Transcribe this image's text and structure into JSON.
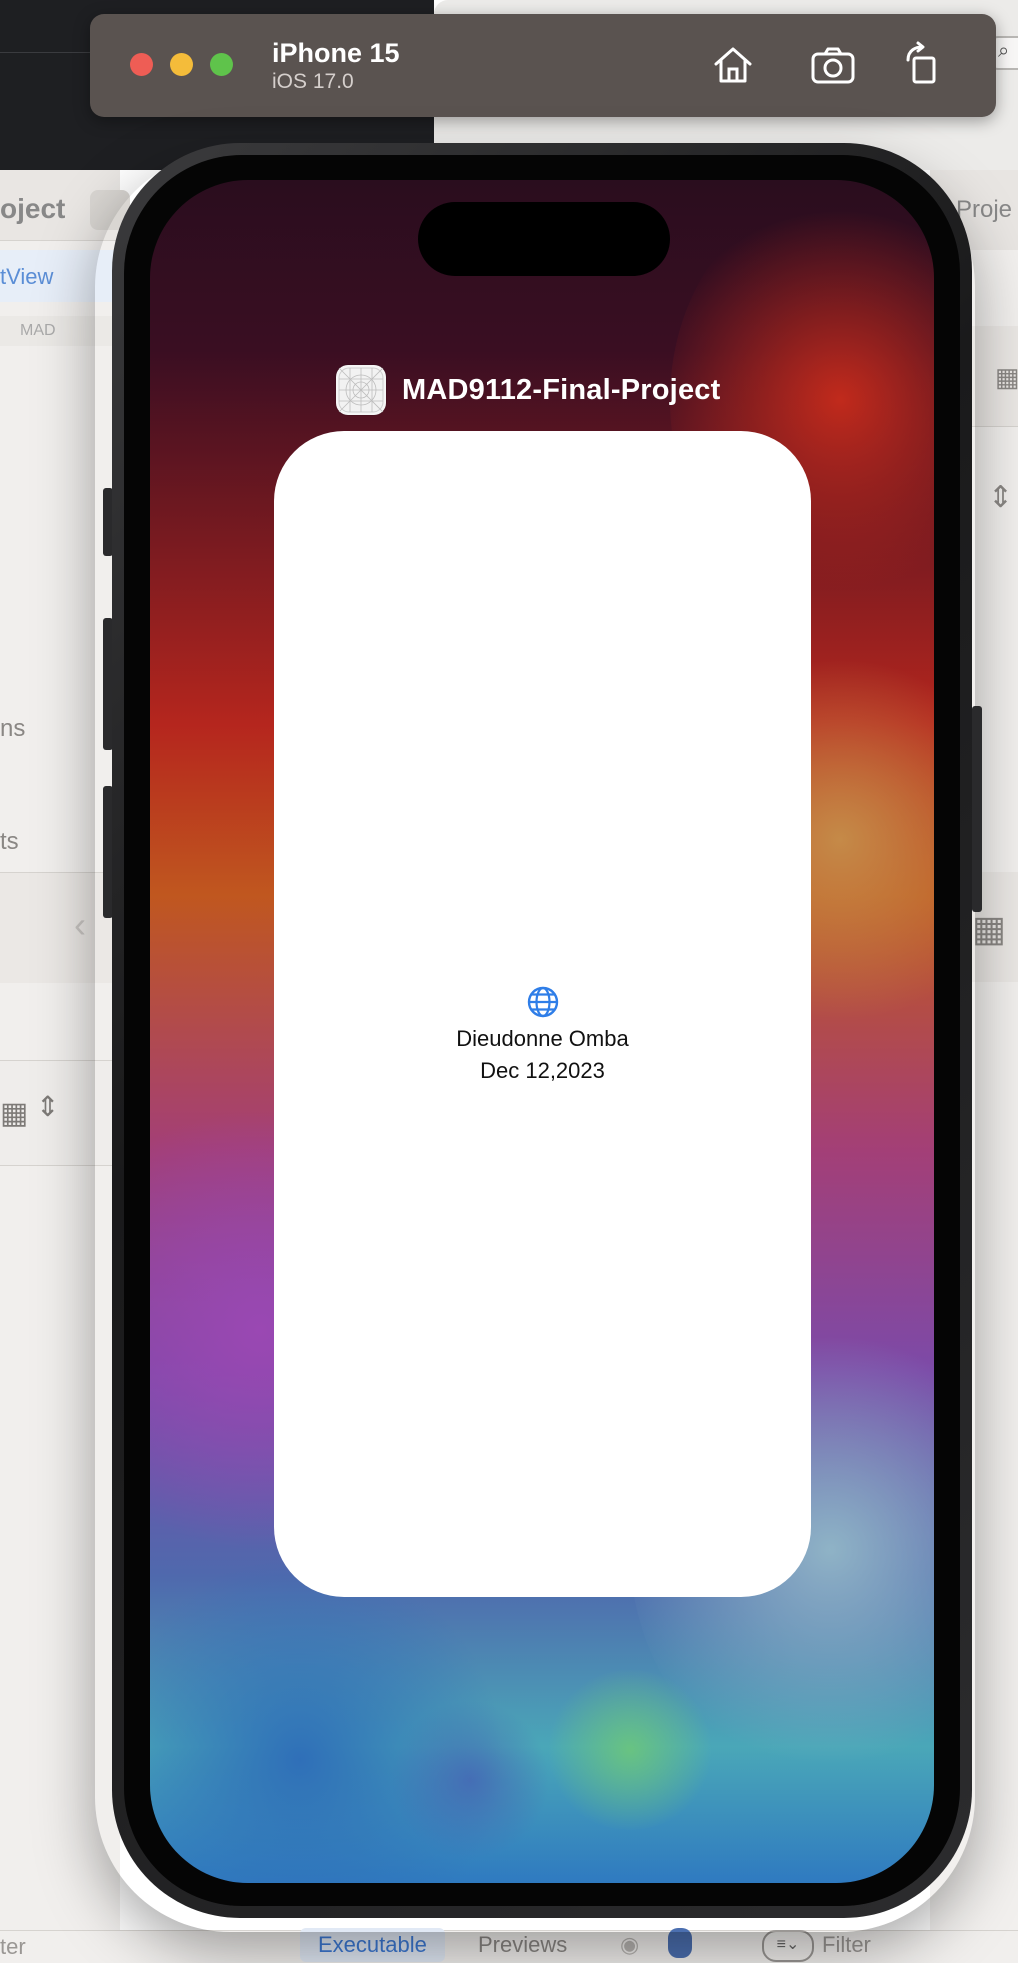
{
  "background_xcode": {
    "project_fragment": "oject",
    "tab_fragment": "tView",
    "row_fragment": "MAD",
    "sidebar_fragment_1": "ns",
    "sidebar_fragment_2": "ts",
    "right_project_fragment": "-Proje",
    "bottom": {
      "filter_left": "ter",
      "executable_label": "Executable",
      "previews_label": "Previews",
      "filter_right": "Filter"
    }
  },
  "simulator": {
    "device_name": "iPhone 15",
    "os_version": "iOS 17.0",
    "buttons": {
      "home": "home-icon",
      "screenshot": "camera-icon",
      "rotate": "rotate-icon"
    }
  },
  "app_switcher": {
    "app_name": "MAD9112-Final-Project",
    "card": {
      "icon": "globe-icon",
      "name": "Dieudonne Omba",
      "date": "Dec 12,2023"
    }
  },
  "colors": {
    "accent": "#2f7ee8",
    "traffic_red": "#ee5d55",
    "traffic_yellow": "#f4bc3a",
    "traffic_green": "#5fc34b"
  }
}
